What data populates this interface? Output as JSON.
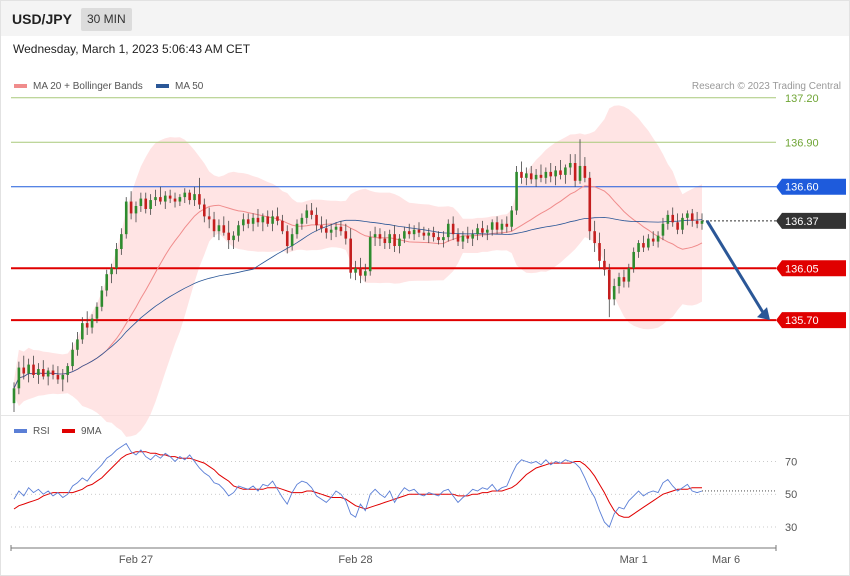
{
  "header": {
    "pair": "USD/JPY",
    "timeframe": "30 MIN",
    "datetime": "Wednesday, March 1, 2023 5:06:43 AM CET",
    "credit": "Research © 2023 Trading Central"
  },
  "legend_price": [
    {
      "label": "MA 20 + Bollinger Bands",
      "color": "#f08c8c"
    },
    {
      "label": "MA 50",
      "color": "#2b5797"
    }
  ],
  "legend_rsi": [
    {
      "label": "RSI",
      "color": "#5b7fd6"
    },
    {
      "label": "9MA",
      "color": "#e00000"
    }
  ],
  "chart_data": [
    {
      "type": "candlestick",
      "ylim": [
        135.06,
        137.32
      ],
      "levels": [
        {
          "value": 137.2,
          "label": "137.20",
          "role": "resistance",
          "color": "#a8c97a"
        },
        {
          "value": 136.9,
          "label": "136.90",
          "role": "resistance",
          "color": "#a8c97a"
        },
        {
          "value": 136.6,
          "label": "136.60",
          "role": "pivot",
          "color": "#1e5bdc"
        },
        {
          "value": 136.37,
          "label": "136.37",
          "role": "last",
          "color": "#333333"
        },
        {
          "value": 136.05,
          "label": "136.05",
          "role": "support",
          "color": "#e00000"
        },
        {
          "value": 135.7,
          "label": "135.70",
          "role": "support",
          "color": "#e00000"
        }
      ],
      "x_ticks": [
        "Feb 27",
        "Feb 28",
        "Mar 1",
        "Mar 6"
      ],
      "candles": [
        [
          135.14,
          135.28,
          135.08,
          135.24
        ],
        [
          135.24,
          135.42,
          135.2,
          135.38
        ],
        [
          135.38,
          135.46,
          135.3,
          135.34
        ],
        [
          135.34,
          135.44,
          135.28,
          135.4
        ],
        [
          135.4,
          135.46,
          135.31,
          135.33
        ],
        [
          135.33,
          135.41,
          135.27,
          135.37
        ],
        [
          135.37,
          135.43,
          135.3,
          135.32
        ],
        [
          135.32,
          135.38,
          135.26,
          135.36
        ],
        [
          135.36,
          135.4,
          135.3,
          135.33
        ],
        [
          135.33,
          135.39,
          135.27,
          135.3
        ],
        [
          135.3,
          135.37,
          135.22,
          135.33
        ],
        [
          135.33,
          135.41,
          135.28,
          135.39
        ],
        [
          135.39,
          135.55,
          135.36,
          135.5
        ],
        [
          135.5,
          135.62,
          135.46,
          135.57
        ],
        [
          135.57,
          135.72,
          135.54,
          135.68
        ],
        [
          135.68,
          135.76,
          135.6,
          135.65
        ],
        [
          135.65,
          135.74,
          135.61,
          135.71
        ],
        [
          135.71,
          135.82,
          135.68,
          135.79
        ],
        [
          135.79,
          135.93,
          135.76,
          135.9
        ],
        [
          135.9,
          136.04,
          135.86,
          136.01
        ],
        [
          136.01,
          136.08,
          135.95,
          136.05
        ],
        [
          136.05,
          136.22,
          136.01,
          136.18
        ],
        [
          136.18,
          136.32,
          136.14,
          136.28
        ],
        [
          136.28,
          136.53,
          136.25,
          136.5
        ],
        [
          136.5,
          136.57,
          136.38,
          136.42
        ],
        [
          136.42,
          136.5,
          136.36,
          136.47
        ],
        [
          136.47,
          136.56,
          136.43,
          136.52
        ],
        [
          136.52,
          136.56,
          136.42,
          136.45
        ],
        [
          136.45,
          136.55,
          136.41,
          136.51
        ],
        [
          136.51,
          136.58,
          136.47,
          136.53
        ],
        [
          136.53,
          136.6,
          136.48,
          136.5
        ],
        [
          136.5,
          136.57,
          136.45,
          136.54
        ],
        [
          136.54,
          136.58,
          136.49,
          136.52
        ],
        [
          136.52,
          136.56,
          136.46,
          136.5
        ],
        [
          136.5,
          136.55,
          136.47,
          136.53
        ],
        [
          136.53,
          136.59,
          136.49,
          136.56
        ],
        [
          136.56,
          136.58,
          136.48,
          136.51
        ],
        [
          136.51,
          136.6,
          136.47,
          136.55
        ],
        [
          136.55,
          136.66,
          136.45,
          136.48
        ],
        [
          136.48,
          136.52,
          136.36,
          136.4
        ],
        [
          136.4,
          136.46,
          136.32,
          136.38
        ],
        [
          136.38,
          136.43,
          136.26,
          136.3
        ],
        [
          136.3,
          136.38,
          136.24,
          136.34
        ],
        [
          136.34,
          136.4,
          136.27,
          136.29
        ],
        [
          136.29,
          136.37,
          136.18,
          136.24
        ],
        [
          136.24,
          136.3,
          136.18,
          136.27
        ],
        [
          136.27,
          136.37,
          136.23,
          136.34
        ],
        [
          136.34,
          136.42,
          136.3,
          136.38
        ],
        [
          136.38,
          136.42,
          136.32,
          136.35
        ],
        [
          136.35,
          136.42,
          136.3,
          136.39
        ],
        [
          136.39,
          136.45,
          136.33,
          136.36
        ],
        [
          136.36,
          136.42,
          136.3,
          136.4
        ],
        [
          136.4,
          136.44,
          136.33,
          136.35
        ],
        [
          136.35,
          136.44,
          136.3,
          136.4
        ],
        [
          136.4,
          136.46,
          136.34,
          136.37
        ],
        [
          136.37,
          136.41,
          136.28,
          136.3
        ],
        [
          136.3,
          136.34,
          136.15,
          136.2
        ],
        [
          136.2,
          136.32,
          136.17,
          136.28
        ],
        [
          136.28,
          136.38,
          136.25,
          136.35
        ],
        [
          136.35,
          136.42,
          136.31,
          136.39
        ],
        [
          136.39,
          136.48,
          136.35,
          136.44
        ],
        [
          136.44,
          136.49,
          136.38,
          136.41
        ],
        [
          136.41,
          136.46,
          136.3,
          136.34
        ],
        [
          136.34,
          136.4,
          136.29,
          136.32
        ],
        [
          136.32,
          136.38,
          136.25,
          136.29
        ],
        [
          136.29,
          136.35,
          136.24,
          136.31
        ],
        [
          136.31,
          136.36,
          136.26,
          136.33
        ],
        [
          136.33,
          136.37,
          136.27,
          136.3
        ],
        [
          136.3,
          136.35,
          136.21,
          136.25
        ],
        [
          136.25,
          136.32,
          135.98,
          136.02
        ],
        [
          136.02,
          136.1,
          135.97,
          136.05
        ],
        [
          136.05,
          136.12,
          135.95,
          136.0
        ],
        [
          136.0,
          136.08,
          135.96,
          136.03
        ],
        [
          136.03,
          136.3,
          136.0,
          136.26
        ],
        [
          136.26,
          136.33,
          136.2,
          136.28
        ],
        [
          136.28,
          136.32,
          136.2,
          136.25
        ],
        [
          136.25,
          136.3,
          136.18,
          136.22
        ],
        [
          136.22,
          136.31,
          136.18,
          136.28
        ],
        [
          136.28,
          136.34,
          136.16,
          136.2
        ],
        [
          136.2,
          136.28,
          136.15,
          136.25
        ],
        [
          136.25,
          136.33,
          136.22,
          136.3
        ],
        [
          136.3,
          136.35,
          136.25,
          136.28
        ],
        [
          136.28,
          136.34,
          136.24,
          136.31
        ],
        [
          136.31,
          136.36,
          136.26,
          136.29
        ],
        [
          136.29,
          136.33,
          136.24,
          136.27
        ],
        [
          136.27,
          136.32,
          136.22,
          136.29
        ],
        [
          136.29,
          136.33,
          136.23,
          136.26
        ],
        [
          136.26,
          136.3,
          136.21,
          136.24
        ],
        [
          136.24,
          136.3,
          136.19,
          136.26
        ],
        [
          136.26,
          136.38,
          136.23,
          136.35
        ],
        [
          136.35,
          136.4,
          136.24,
          136.28
        ],
        [
          136.28,
          136.32,
          136.2,
          136.23
        ],
        [
          136.23,
          136.3,
          136.18,
          136.27
        ],
        [
          136.27,
          136.33,
          136.22,
          136.25
        ],
        [
          136.25,
          136.31,
          136.2,
          136.28
        ],
        [
          136.28,
          136.35,
          136.24,
          136.32
        ],
        [
          136.32,
          136.37,
          136.26,
          136.29
        ],
        [
          136.29,
          136.34,
          136.24,
          136.31
        ],
        [
          136.31,
          136.38,
          136.27,
          136.36
        ],
        [
          136.36,
          136.4,
          136.28,
          136.31
        ],
        [
          136.31,
          136.38,
          136.28,
          136.35
        ],
        [
          136.35,
          136.4,
          136.29,
          136.33
        ],
        [
          136.33,
          136.47,
          136.3,
          136.44
        ],
        [
          136.44,
          136.74,
          136.41,
          136.7
        ],
        [
          136.7,
          136.77,
          136.62,
          136.66
        ],
        [
          136.66,
          136.73,
          136.61,
          136.69
        ],
        [
          136.69,
          136.74,
          136.62,
          136.65
        ],
        [
          136.65,
          136.72,
          136.6,
          136.68
        ],
        [
          136.68,
          136.75,
          136.63,
          136.66
        ],
        [
          136.66,
          136.73,
          136.62,
          136.7
        ],
        [
          136.7,
          136.76,
          136.63,
          136.67
        ],
        [
          136.67,
          136.74,
          136.61,
          136.71
        ],
        [
          136.71,
          136.78,
          136.65,
          136.68
        ],
        [
          136.68,
          136.75,
          136.62,
          136.73
        ],
        [
          136.73,
          136.82,
          136.68,
          136.76
        ],
        [
          136.76,
          136.82,
          136.6,
          136.64
        ],
        [
          136.64,
          136.92,
          136.62,
          136.74
        ],
        [
          136.74,
          136.8,
          136.63,
          136.66
        ],
        [
          136.66,
          136.7,
          136.24,
          136.3
        ],
        [
          136.3,
          136.37,
          136.16,
          136.22
        ],
        [
          136.22,
          136.29,
          136.05,
          136.1
        ],
        [
          136.1,
          136.18,
          136.0,
          136.04
        ],
        [
          136.04,
          136.08,
          135.72,
          135.84
        ],
        [
          135.84,
          135.98,
          135.8,
          135.93
        ],
        [
          135.93,
          136.02,
          135.88,
          135.99
        ],
        [
          135.99,
          136.04,
          135.92,
          135.96
        ],
        [
          135.96,
          136.08,
          135.92,
          136.05
        ],
        [
          136.05,
          136.19,
          136.02,
          136.16
        ],
        [
          136.16,
          136.24,
          136.12,
          136.22
        ],
        [
          136.22,
          136.27,
          136.16,
          136.19
        ],
        [
          136.19,
          136.28,
          136.17,
          136.25
        ],
        [
          136.25,
          136.3,
          136.2,
          136.23
        ],
        [
          136.23,
          136.3,
          136.19,
          136.27
        ],
        [
          136.27,
          136.39,
          136.24,
          136.35
        ],
        [
          136.35,
          136.44,
          136.31,
          136.41
        ],
        [
          136.41,
          136.46,
          136.33,
          136.36
        ],
        [
          136.36,
          136.42,
          136.28,
          136.31
        ],
        [
          136.31,
          136.42,
          136.28,
          136.39
        ],
        [
          136.39,
          136.44,
          136.34,
          136.42
        ],
        [
          136.42,
          136.45,
          136.33,
          136.37
        ],
        [
          136.37,
          136.43,
          136.32,
          136.35
        ],
        [
          136.35,
          136.42,
          136.31,
          136.37
        ]
      ],
      "projection": {
        "from": 136.37,
        "to": 135.7
      }
    },
    {
      "type": "line",
      "ylim": [
        19,
        88
      ],
      "y_ticks": [
        70,
        50,
        30
      ],
      "series": [
        {
          "name": "RSI",
          "values": [
            47,
            52,
            49,
            54,
            51,
            53,
            50,
            52,
            49,
            51,
            48,
            50,
            55,
            57,
            60,
            58,
            62,
            65,
            68,
            72,
            74,
            77,
            79,
            81,
            76,
            74,
            77,
            73,
            71,
            74,
            72,
            75,
            73,
            70,
            73,
            71,
            74,
            70,
            66,
            63,
            61,
            57,
            56,
            53,
            49,
            51,
            55,
            54,
            53,
            55,
            52,
            56,
            55,
            58,
            53,
            48,
            44,
            51,
            56,
            58,
            57,
            54,
            49,
            47,
            45,
            48,
            52,
            50,
            46,
            38,
            36,
            44,
            40,
            50,
            53,
            50,
            48,
            52,
            45,
            50,
            54,
            52,
            53,
            50,
            49,
            51,
            50,
            49,
            52,
            53,
            49,
            45,
            48,
            50,
            53,
            52,
            54,
            53,
            56,
            52,
            54,
            55,
            62,
            68,
            71,
            70,
            69,
            70,
            68,
            71,
            68,
            70,
            69,
            71,
            70,
            69,
            66,
            60,
            53,
            48,
            40,
            33,
            30,
            38,
            42,
            41,
            46,
            49,
            52,
            49,
            51,
            52,
            51,
            57,
            59,
            55,
            52,
            54,
            56,
            52,
            51,
            52
          ]
        },
        {
          "name": "9MA",
          "values": [
            41,
            43,
            44,
            45,
            46,
            47,
            49,
            50,
            51,
            51,
            51,
            51,
            51,
            52,
            53,
            55,
            56,
            58,
            60,
            63,
            66,
            69,
            72,
            74,
            75,
            76,
            76,
            76,
            75,
            75,
            74,
            74,
            73,
            73,
            72,
            72,
            72,
            71,
            70,
            69,
            67,
            65,
            62,
            60,
            58,
            55,
            54,
            53,
            53,
            53,
            53,
            53,
            54,
            54,
            54,
            53,
            52,
            51,
            51,
            51,
            52,
            52,
            51,
            50,
            49,
            48,
            48,
            48,
            47,
            45,
            43,
            42,
            41,
            42,
            43,
            44,
            45,
            46,
            47,
            48,
            49,
            50,
            50,
            50,
            50,
            50,
            50,
            50,
            50,
            50,
            50,
            49,
            49,
            49,
            50,
            50,
            51,
            51,
            52,
            52,
            52,
            53,
            54,
            56,
            59,
            62,
            64,
            66,
            67,
            68,
            69,
            69,
            69,
            69,
            69,
            70,
            70,
            68,
            65,
            61,
            56,
            51,
            45,
            40,
            37,
            36,
            36,
            38,
            40,
            42,
            44,
            46,
            48,
            50,
            51,
            52,
            53,
            53,
            53,
            54,
            54,
            54
          ]
        }
      ]
    }
  ]
}
